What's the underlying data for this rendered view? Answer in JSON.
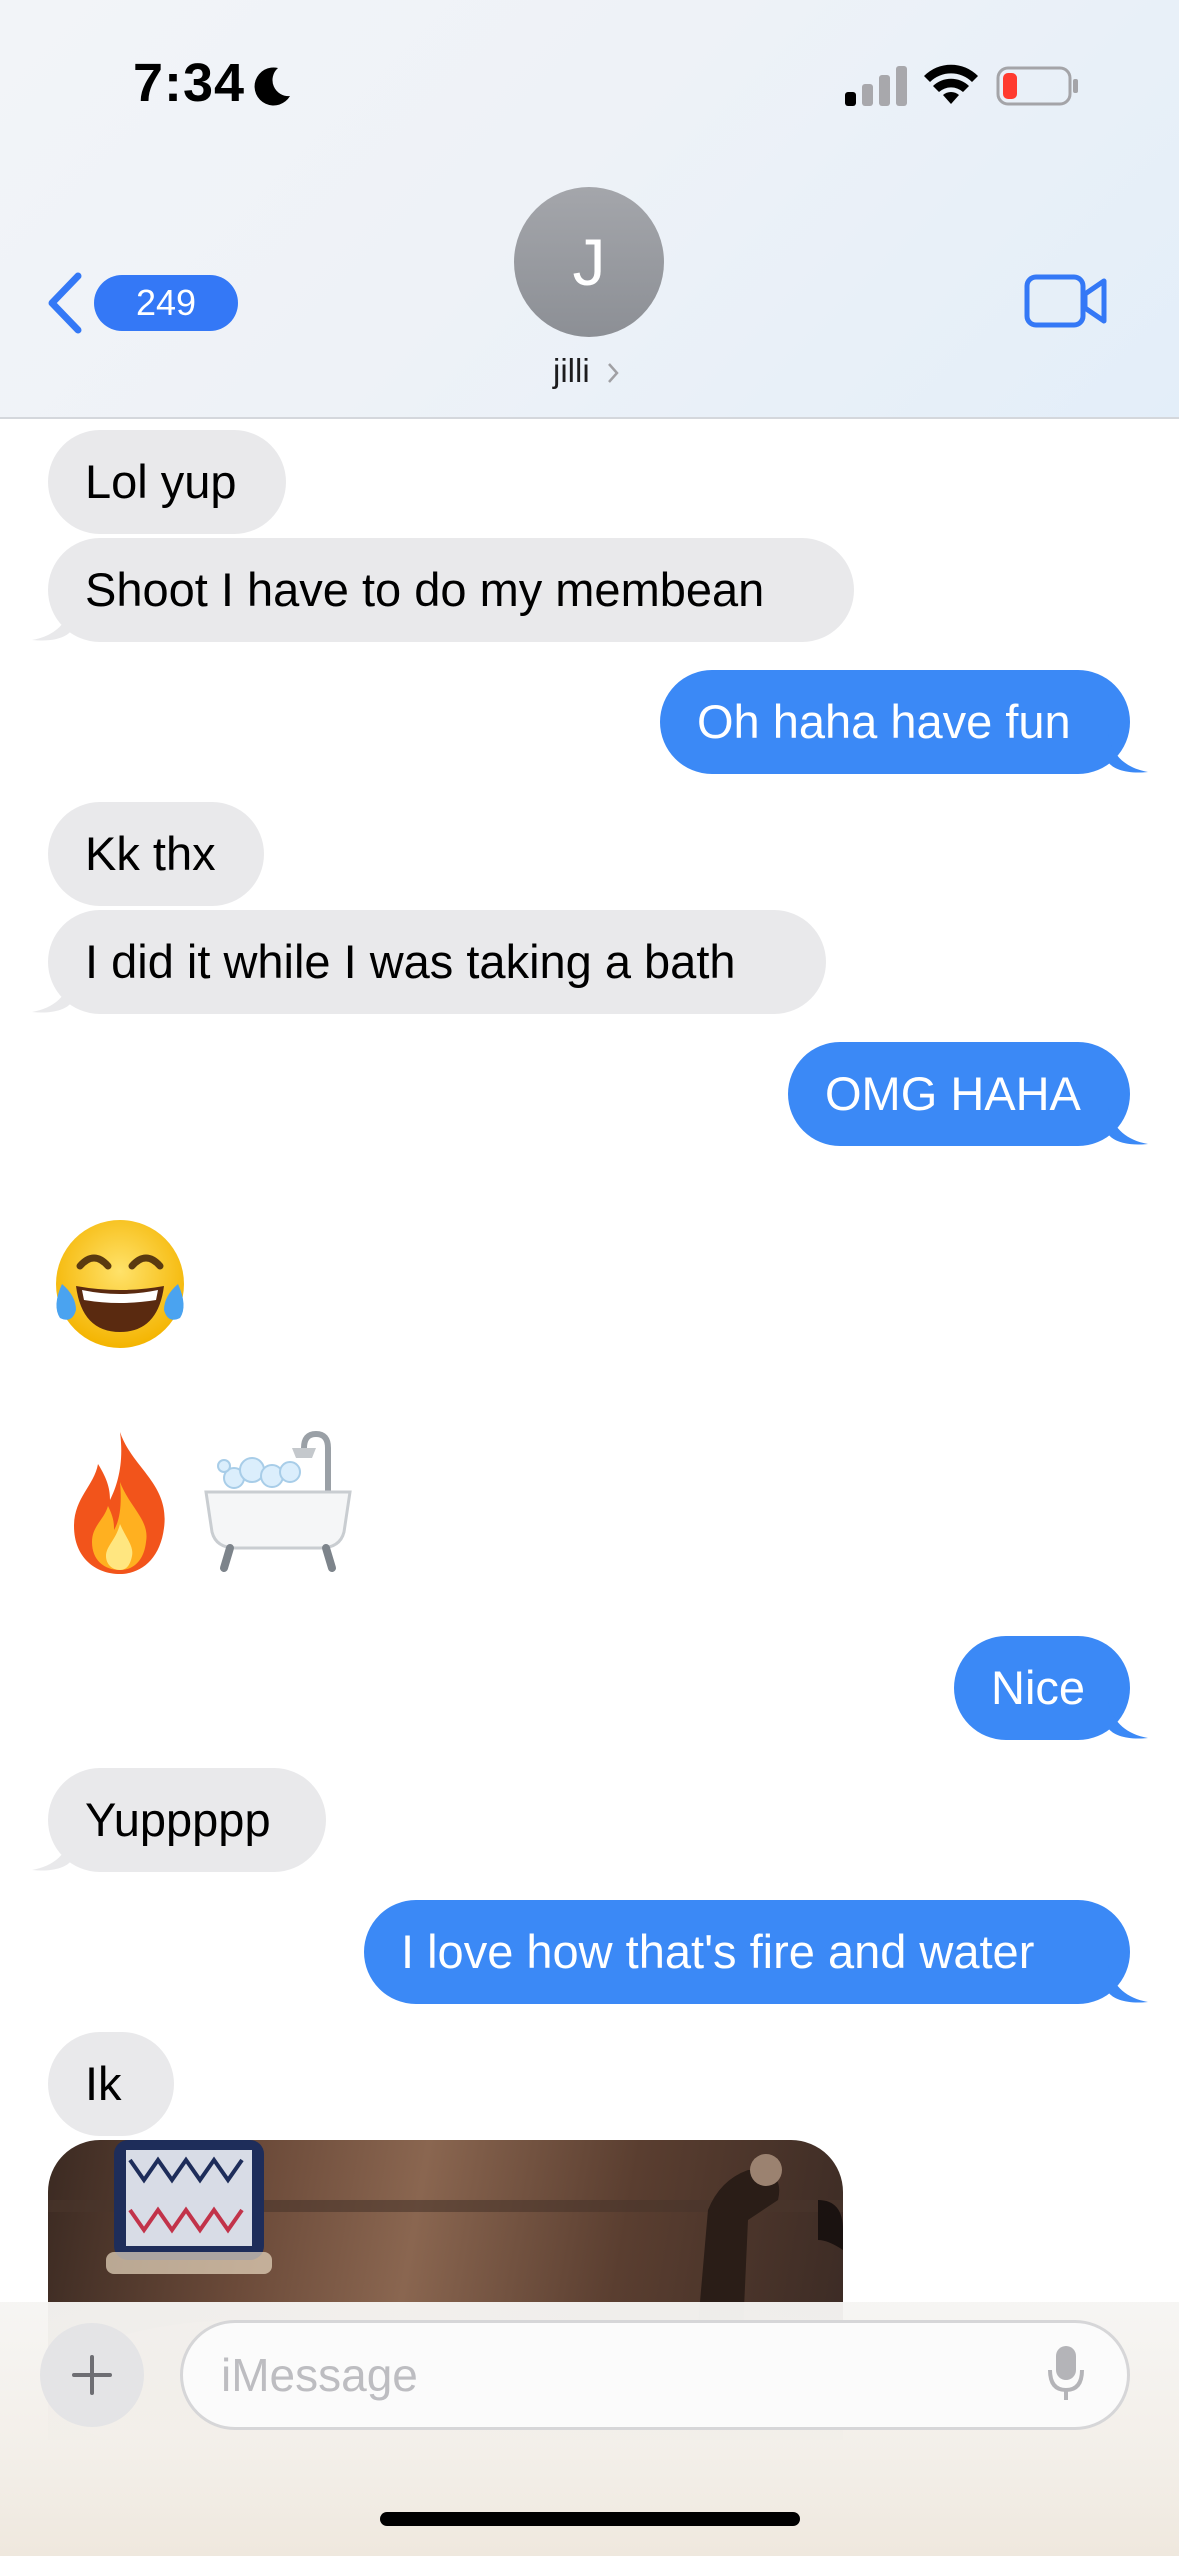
{
  "status_bar": {
    "time": "7:34"
  },
  "header": {
    "back_count": "249",
    "avatar_initial": "J",
    "contact_name": "jilli"
  },
  "messages": [
    {
      "text": "Lol yup",
      "direction": "received"
    },
    {
      "text": "Shoot I have to do my membean",
      "direction": "received"
    },
    {
      "text": "Oh haha have fun",
      "direction": "sent"
    },
    {
      "text": "Kk thx",
      "direction": "received"
    },
    {
      "text": "I did it while I was taking a bath",
      "direction": "received"
    },
    {
      "text": "OMG HAHA",
      "direction": "sent"
    },
    {
      "text": "😂",
      "direction": "received",
      "kind": "emoji"
    },
    {
      "text": "🔥🛁",
      "direction": "received",
      "kind": "emoji"
    },
    {
      "text": "Nice",
      "direction": "sent"
    },
    {
      "text": "Yuppppp",
      "direction": "received"
    },
    {
      "text": "I love how that's fire and water",
      "direction": "sent"
    },
    {
      "text": "Ik",
      "direction": "received"
    }
  ],
  "input": {
    "placeholder": "iMessage"
  },
  "colors": {
    "sent_bubble": "#3b89f6",
    "received_bubble": "#e9e9eb",
    "accent": "#3478f6"
  }
}
